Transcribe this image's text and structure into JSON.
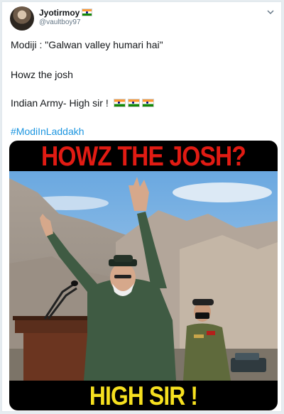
{
  "user": {
    "name": "Jyotirmoy",
    "handle": "@vaultboy97",
    "verified_flag_icon": "india-flag-icon"
  },
  "menu_icon": "chevron-down-icon",
  "tweet": {
    "lines": [
      "Modiji : \"Galwan valley humari hai\"",
      "Howz the josh",
      "Indian Army- High sir !",
      "#ModiInLaddakh"
    ],
    "flag_count": 3,
    "hashtag_color": "#1b95e0"
  },
  "media": {
    "top_text": "HOWZ THE JOSH?",
    "bottom_text": "HIGH SIR !",
    "top_text_color": "#e11b13",
    "bottom_text_color": "#f6e01f"
  }
}
